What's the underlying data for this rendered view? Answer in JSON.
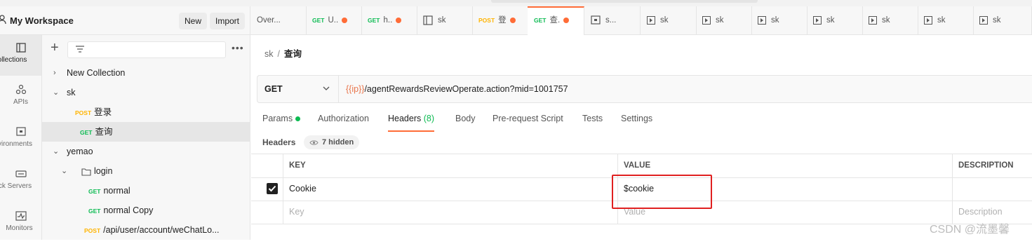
{
  "workspace": {
    "title": "My Workspace",
    "new_label": "New",
    "import_label": "Import"
  },
  "rail": [
    {
      "label": "Collections",
      "icon": "collections-icon"
    },
    {
      "label": "APIs",
      "icon": "apis-icon"
    },
    {
      "label": "Environments",
      "icon": "environments-icon"
    },
    {
      "label": "Mock Servers",
      "icon": "mock-servers-icon"
    },
    {
      "label": "Monitors",
      "icon": "monitors-icon"
    }
  ],
  "rail_visible": [
    "ollections",
    "APIs",
    "vironments",
    "ck Servers",
    "Monitors"
  ],
  "sidebar": {
    "tree": [
      {
        "label": "New Collection"
      },
      {
        "label": "sk"
      },
      {
        "method": "POST",
        "label": "登录"
      },
      {
        "method": "GET",
        "label": "查询"
      },
      {
        "label": "yemao"
      },
      {
        "label": "login"
      },
      {
        "method": "GET",
        "label": "normal"
      },
      {
        "method": "GET",
        "label": "normal Copy"
      },
      {
        "method": "POST",
        "label": "/api/user/account/weChatLo..."
      }
    ]
  },
  "tabs": [
    {
      "label": "Over..."
    },
    {
      "method": "GET",
      "label": "U.."
    },
    {
      "method": "GET",
      "label": "h.."
    },
    {
      "label": "sk"
    },
    {
      "method": "POST",
      "label": "登"
    },
    {
      "method": "GET",
      "label": "查."
    },
    {
      "label": "s..."
    },
    {
      "label": "sk"
    },
    {
      "label": "sk"
    },
    {
      "label": "sk"
    },
    {
      "label": "sk"
    },
    {
      "label": "sk"
    },
    {
      "label": "sk"
    },
    {
      "label": "sk"
    }
  ],
  "breadcrumb": {
    "parent": "sk",
    "separator": "/",
    "current": "查询"
  },
  "request": {
    "method": "GET",
    "url_var": "{{ip}}",
    "url_rest": "/agentRewardsReviewOperate.action?mid=1001757"
  },
  "request_tabs": {
    "params": "Params",
    "authorization": "Authorization",
    "headers": "Headers",
    "headers_count": "(8)",
    "body": "Body",
    "prerequest": "Pre-request Script",
    "tests": "Tests",
    "settings": "Settings"
  },
  "headers_section": {
    "label": "Headers",
    "hidden": "7 hidden"
  },
  "headers_table": {
    "columns": {
      "key": "KEY",
      "value": "VALUE",
      "description": "DESCRIPTION"
    },
    "rows": [
      {
        "key": "Cookie",
        "value": "$cookie",
        "description": ""
      }
    ],
    "placeholder": {
      "key": "Key",
      "value": "Value",
      "description": "Description"
    }
  },
  "watermark": "CSDN @流墨馨",
  "colors": {
    "accent": "#ff6c37",
    "get": "#0cbb52",
    "post": "#ffb400",
    "highlight": "#e02020"
  }
}
